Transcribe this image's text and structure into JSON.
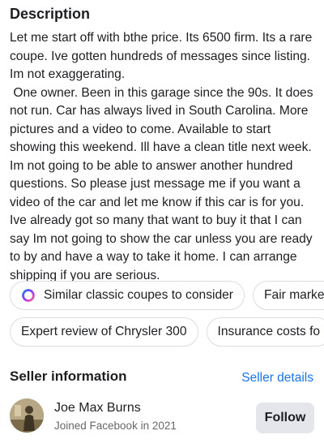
{
  "description": {
    "title": "Description",
    "text": "Let me start off with bthe price. Its 6500 firm. Its a rare coupe. Ive gotten hundreds of messages since listing. Im not exaggerating.\n One owner. Been in this garage since the 90s. It does not run. Car has always lived in South Carolina. More pictures and a video to come. Available to start showing this weekend. Ill have a clean title next week. Im not going to be able to answer another hundred questions. So please just message me if you want a video of the car and let me know if this car is for you. Ive already got so many that want to buy it that I can say Im not going to show the car unless you are ready to by and have a way to take it home. I can arrange shipping if you are serious."
  },
  "suggestions": {
    "row1": [
      {
        "label": "Similar classic coupes to consider",
        "icon": "meta-ai-icon"
      },
      {
        "label": "Fair market"
      }
    ],
    "row2": [
      {
        "label": "Expert review of Chrysler 300"
      },
      {
        "label": "Insurance costs fo"
      }
    ]
  },
  "seller": {
    "title": "Seller information",
    "details_link": "Seller details",
    "name": "Joe Max Burns",
    "joined": "Joined Facebook in 2021",
    "follow_label": "Follow"
  },
  "colors": {
    "link": "#1a73e8",
    "chip_border": "#dadde1",
    "button_bg": "#e4e6eb",
    "secondary_text": "#65676b"
  }
}
